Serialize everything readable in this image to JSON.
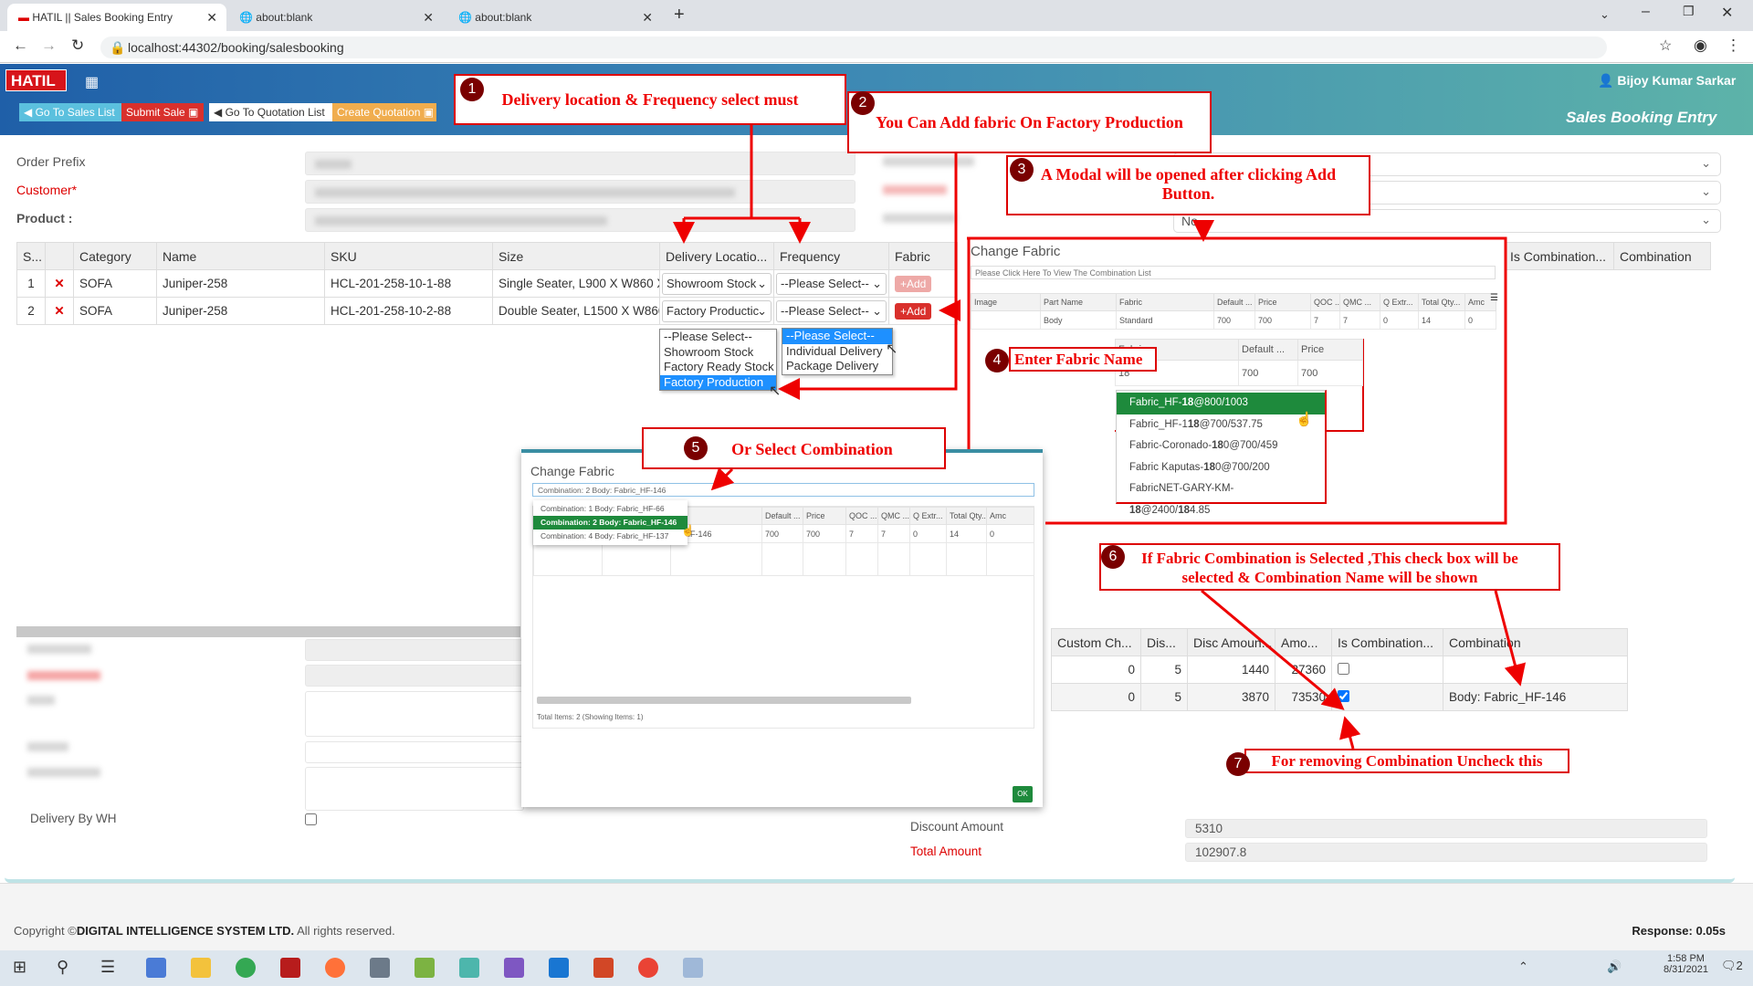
{
  "browser": {
    "tabs": [
      {
        "title": "HATIL || Sales Booking Entry",
        "active": true
      },
      {
        "title": "about:blank"
      },
      {
        "title": "about:blank"
      }
    ],
    "new_tab": "+",
    "url": "localhost:44302/booking/salesbooking"
  },
  "app": {
    "logo": "HATIL",
    "buttons": {
      "sales_list": "Go To Sales List",
      "submit_sale": "Submit Sale",
      "quotation_list": "Go To Quotation List",
      "create_quotation": "Create Quotation"
    },
    "user": "Bijoy Kumar Sarkar",
    "page_title": "Sales Booking Entry",
    "colors": {
      "header_start": "#1f5fa8",
      "header_end": "#5db3a9",
      "danger": "#d9302c",
      "success": "#1e8a3c",
      "info": "#5bc0de",
      "warning": "#f0ad4e"
    }
  },
  "form": {
    "order_prefix_label": "Order Prefix",
    "customer_label": "Customer*",
    "product_label": "Product :",
    "right_select_value": "No",
    "delivery_by_wh_label": "Delivery By WH",
    "discount_amount_label": "Discount Amount",
    "discount_amount": "5310",
    "total_amount_label": "Total Amount",
    "total_amount": "102907.8"
  },
  "product_table": {
    "columns": [
      "S...",
      "",
      "Category",
      "Name",
      "SKU",
      "Size",
      "Delivery Locatio...",
      "Frequency",
      "Fabric"
    ],
    "right_columns": [
      "Is Combination...",
      "Combination"
    ],
    "rows": [
      {
        "sn": "1",
        "category": "SOFA",
        "name": "Juniper-258",
        "sku": "HCL-201-258-10-1-88",
        "size": "Single Seater, L900 X W860 X",
        "delivery": "Showroom Stock",
        "frequency": "--Please Select--",
        "fabric_btn": "+Add",
        "fabric_enabled": false
      },
      {
        "sn": "2",
        "category": "SOFA",
        "name": "Juniper-258",
        "sku": "HCL-201-258-10-2-88",
        "size": "Double Seater, L1500 X W860",
        "delivery": "Factory Productic",
        "frequency": "--Please Select--",
        "fabric_btn": "+Add",
        "fabric_enabled": true
      }
    ]
  },
  "delivery_options": [
    "--Please Select--",
    "Showroom Stock",
    "Factory Ready Stock",
    "Factory Production"
  ],
  "delivery_selected": "Factory Production",
  "frequency_options": [
    "--Please Select--",
    "Individual Delivery",
    "Package Delivery"
  ],
  "frequency_selected": "--Please Select--",
  "amount_table": {
    "columns": [
      "Custom Ch...",
      "Dis...",
      "Disc Amoun...",
      "Amo...",
      "Is Combination...",
      "Combination"
    ],
    "rows": [
      {
        "custom": "0",
        "dis": "5",
        "disc_amount": "1440",
        "amount": "27360",
        "is_combination": false,
        "combination": ""
      },
      {
        "custom": "0",
        "dis": "5",
        "disc_amount": "3870",
        "amount": "73530",
        "is_combination": true,
        "combination": "Body: Fabric_HF-146"
      }
    ]
  },
  "fabric_modal": {
    "title": "Change Fabric",
    "placeholder": "Please Click Here To View The Combination List",
    "columns": [
      "Image",
      "Part Name",
      "Fabric",
      "Default ...",
      "Price",
      "QOC ...",
      "QMC ...",
      "Q Extr...",
      "Total Qty...",
      "Amc"
    ],
    "row": [
      "",
      "Body",
      "Standard",
      "700",
      "700",
      "7",
      "7",
      "0",
      "14",
      "0"
    ],
    "editor": {
      "columns": [
        "Fabric",
        "Default ...",
        "Price"
      ],
      "input": "18",
      "default": "700",
      "price": "700"
    },
    "suggestions": [
      {
        "pre": "Fabric_HF-",
        "match": "18",
        "post": "@800/1003"
      },
      {
        "pre": "Fabric_HF-1",
        "match": "18",
        "post": "@700/537.75"
      },
      {
        "pre": "Fabric-Coronado-",
        "match": "18",
        "post": "0@700/459"
      },
      {
        "pre": "Fabric Kaputas-",
        "match": "18",
        "post": "0@700/200"
      },
      {
        "pre": "FabricNET-GARY-KM-",
        "match": "18",
        "post": "@2400/",
        "match2": "18",
        "post2": "4.85"
      }
    ]
  },
  "combination_modal": {
    "title": "Change Fabric",
    "input_value": "Combination: 2 Body: Fabric_HF-146",
    "options": [
      "Combination: 1 Body: Fabric_HF-66",
      "Combination: 2 Body: Fabric_HF-146",
      "Combination: 4 Body: Fabric_HF-137"
    ],
    "selected_index": 1,
    "columns": [
      "",
      "",
      "ric",
      "Default ...",
      "Price",
      "QOC ...",
      "QMC ...",
      "Q Extr...",
      "Total Qty...",
      "Amc"
    ],
    "row": [
      "",
      "",
      "ic_HF-146",
      "700",
      "700",
      "7",
      "7",
      "0",
      "14",
      "0"
    ],
    "total_items": "Total Items: 2 (Showing Items: 1)",
    "ok": "OK"
  },
  "annotations": [
    {
      "n": "1",
      "text": "Delivery location & Frequency select must"
    },
    {
      "n": "2",
      "text": "You Can Add fabric On Factory Production"
    },
    {
      "n": "3",
      "text": "A Modal will be opened after clicking Add Button."
    },
    {
      "n": "4",
      "text": "Enter Fabric Name"
    },
    {
      "n": "5",
      "text": "Or Select Combination"
    },
    {
      "n": "6",
      "text": "If Fabric Combination is Selected ,This check box will be selected & Combination Name will be shown"
    },
    {
      "n": "7",
      "text": "For removing Combination Uncheck this"
    }
  ],
  "footer": {
    "copyright_pre": "Copyright ©",
    "company": "DIGITAL INTELLIGENCE SYSTEM LTD.",
    "rights": " All rights reserved.",
    "response": "Response: 0.05s"
  },
  "taskbar": {
    "time": "1:58 PM",
    "date": "8/31/2021",
    "notifications": "2"
  }
}
